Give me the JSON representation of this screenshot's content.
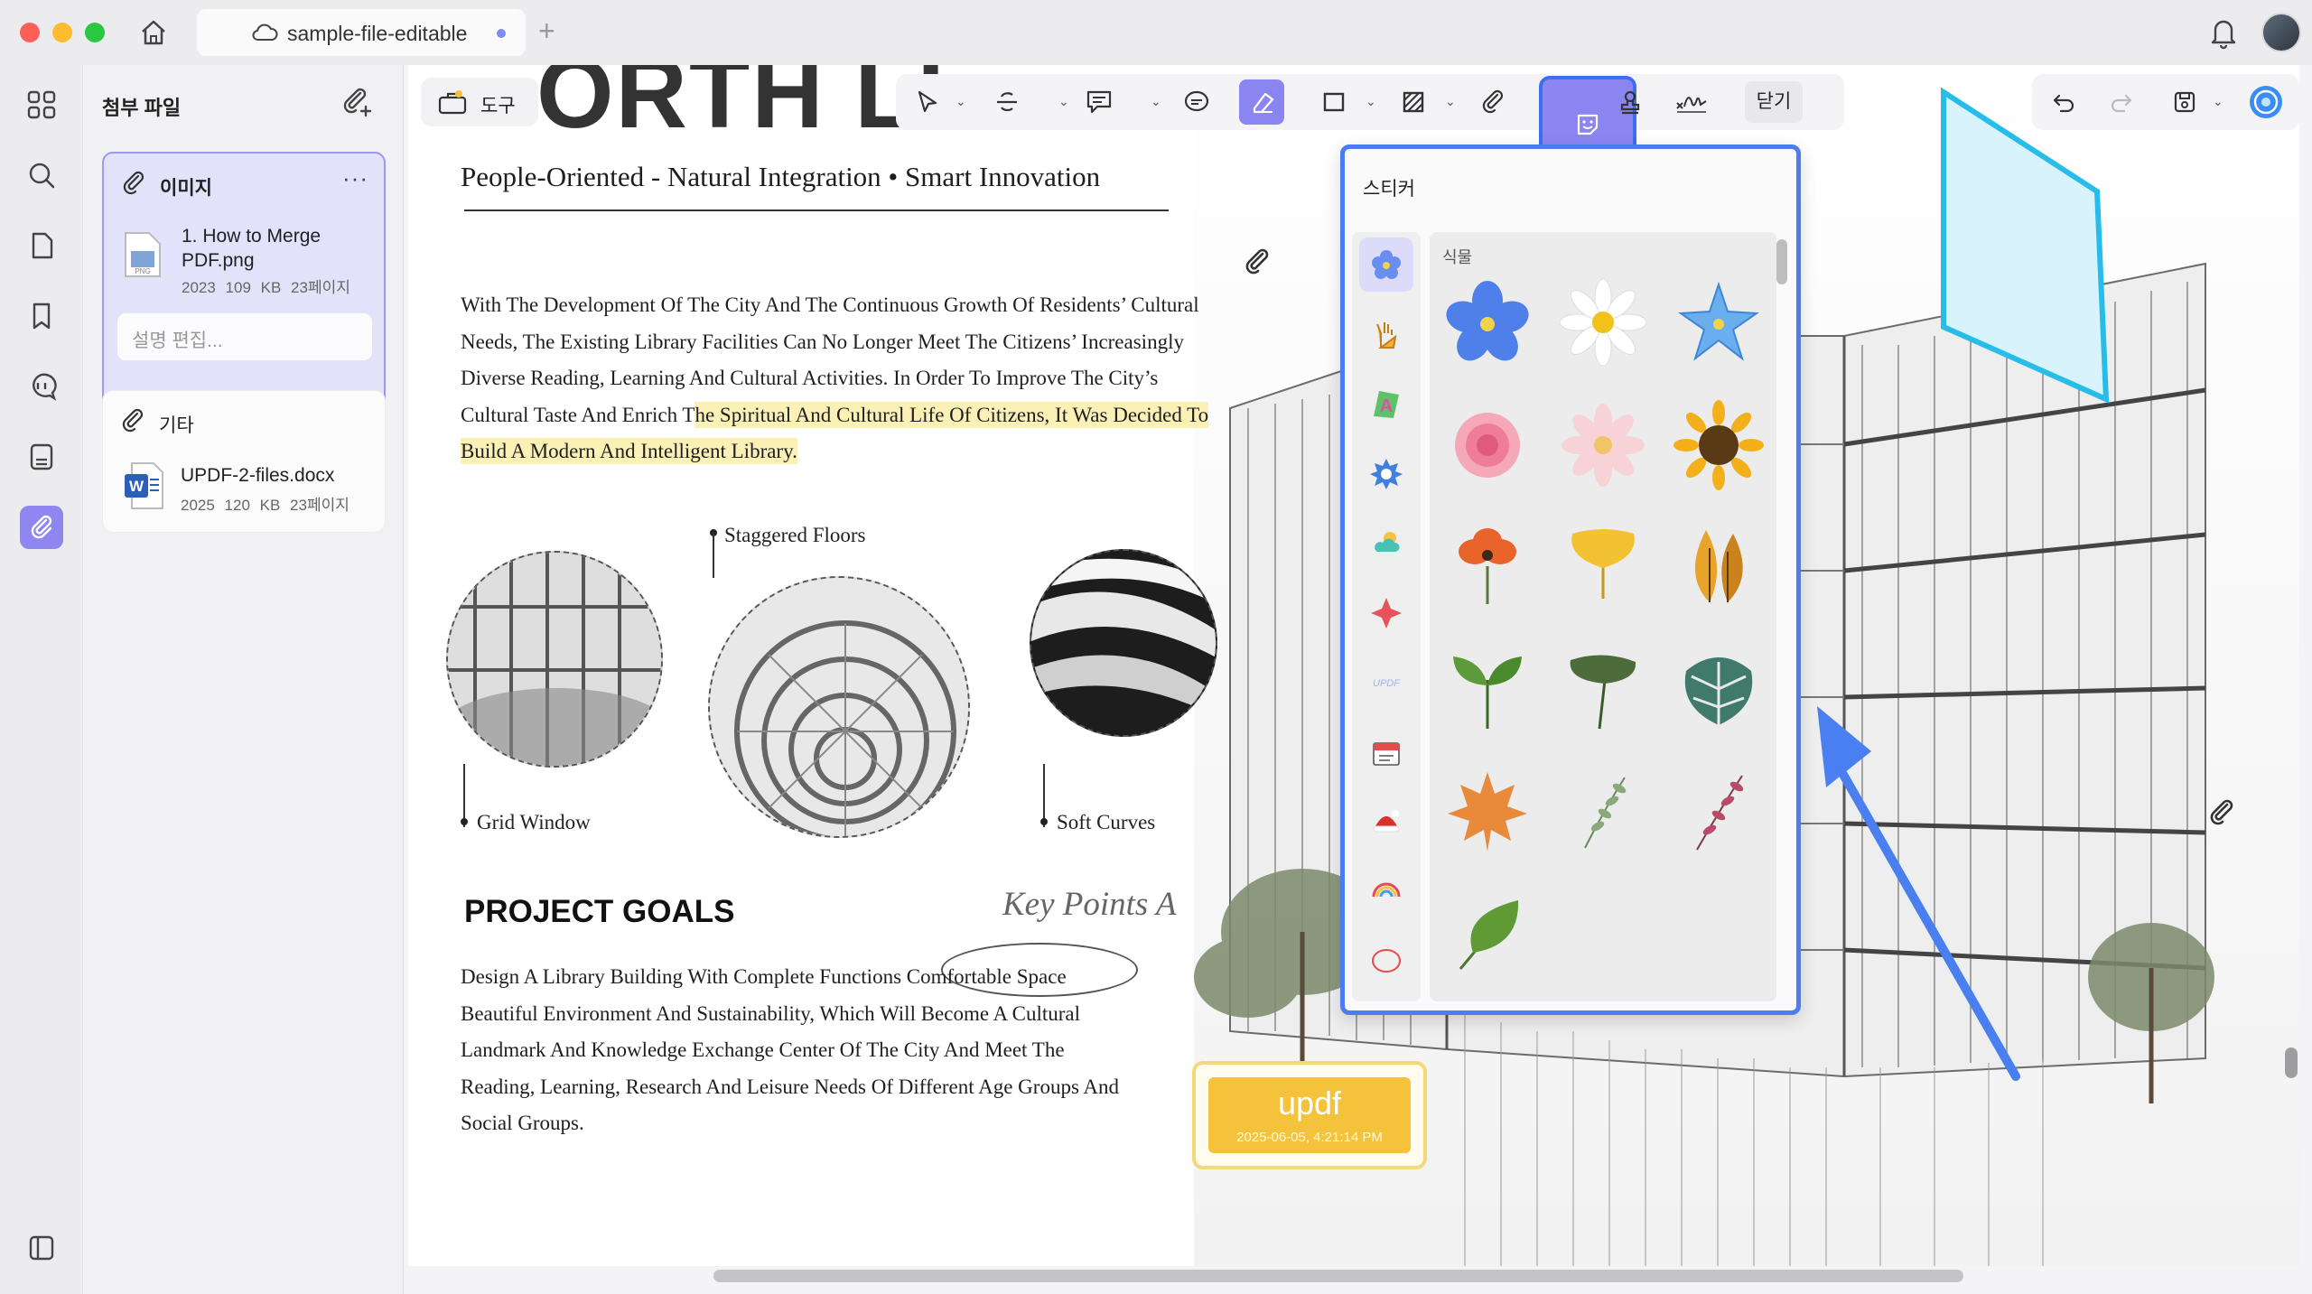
{
  "window": {
    "tab_title": "sample-file-editable",
    "new_tab": "+"
  },
  "attachments": {
    "title": "첨부 파일",
    "groups": [
      {
        "label": "이미지",
        "more": "···",
        "file_name": "1. How to Merge PDF.png",
        "file_meta": "2023 109 KB 23페이지",
        "description_placeholder": "설명 편집..."
      },
      {
        "label": "기타",
        "file_name": "UPDF-2-files.docx",
        "file_meta": "2025 120 KB 23페이지"
      }
    ]
  },
  "toolbar": {
    "tools_label": "도구",
    "close_label": "닫기"
  },
  "sticker_panel": {
    "title": "스티커",
    "section": "식물"
  },
  "document": {
    "big_title": "ORTH LI",
    "subtitle": "People-Oriented - Natural Integration • Smart Innovation",
    "p1_a": "With The Development Of The City And The Continuous Growth Of Residents’ Cultural Needs, The Existing Library Facilities Can No Longer Meet The Citizens’ Increasingly Diverse Reading, Learning And Cultural Activities. In Order To Improve The City’s Cultural Taste And Enrich T",
    "p1_hl": "he Spiritual And Cultural Life Of Citizens, It Was Decided To Build A Modern And Intelligent Library.",
    "caption_staggered": "Staggered Floors",
    "caption_grid": "Grid Window",
    "caption_soft": "Soft Curves",
    "goals_heading": "PROJECT GOALS",
    "key_points": "Key Points A",
    "p2": "Design A Library Building With Complete Functions Comfortable Space Beautiful Environment And Sustainability, Which Will Become A Cultural Landmark And Knowledge Exchange Center Of The City And Meet The Reading, Learning, Research And Leisure Needs Of Different Age Groups And Social Groups.",
    "stamp_word": "updf",
    "stamp_date": "2025-06-05, 4:21:14 PM"
  },
  "colors": {
    "accent": "#8b85f2",
    "selection_outline": "#3b6ff0",
    "highlight": "#fbf1b6",
    "stamp_fill": "#f4c33b"
  }
}
